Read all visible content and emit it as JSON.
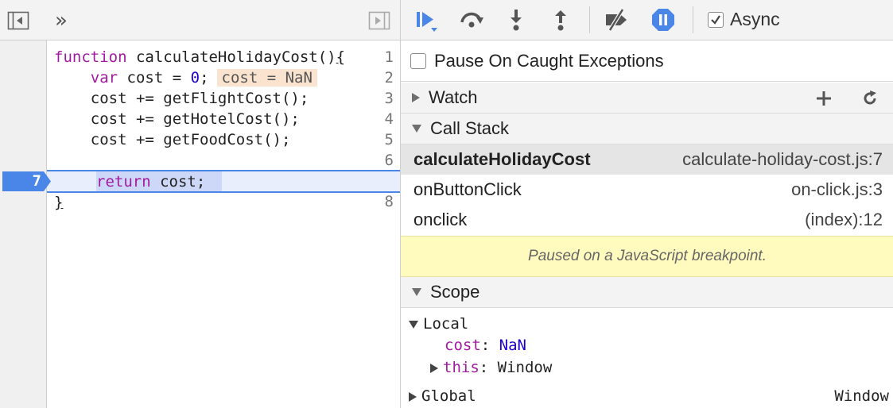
{
  "source": {
    "line_numbers": [
      "1",
      "2",
      "3",
      "4",
      "5",
      "6",
      "7",
      "8"
    ],
    "current_line": "7",
    "lines": {
      "l1_kw": "function",
      "l1_rest": " calculateHolidayCost()",
      "l1_brace": "{",
      "l2_indent": "    ",
      "l2_kw": "var",
      "l2_mid": " cost = ",
      "l2_num": "0",
      "l2_end": ";",
      "l2_inline": "cost = NaN",
      "l3": "    cost += getFlightCost();",
      "l4": "    cost += getHotelCost();",
      "l5": "    cost += getFoodCost();",
      "l7_kw": "return",
      "l7_rest": " cost;",
      "l8": "}"
    }
  },
  "toolbar": {
    "more_tabs": "»",
    "async_label": "Async",
    "async_checked": true
  },
  "pause_on_caught": {
    "label": "Pause On Caught Exceptions",
    "checked": false
  },
  "watch": {
    "title": "Watch"
  },
  "call_stack": {
    "title": "Call Stack",
    "frames": [
      {
        "name": "calculateHolidayCost",
        "location": "calculate-holiday-cost.js:7"
      },
      {
        "name": "onButtonClick",
        "location": "on-click.js:3"
      },
      {
        "name": "onclick",
        "location": "(index):12"
      }
    ]
  },
  "paused_message": "Paused on a JavaScript breakpoint.",
  "scope": {
    "title": "Scope",
    "local": {
      "label": "Local",
      "cost_name": "cost",
      "cost_value": "NaN",
      "this_name": "this",
      "this_value": "Window"
    },
    "global": {
      "label": "Global",
      "value": "Window"
    }
  },
  "colors": {
    "accent": "#4a86e8",
    "keyword": "#a21aa1",
    "number": "#1c00cf",
    "paused_bg": "#fffbbf"
  },
  "icons": [
    "show-navigator-icon",
    "more-tabs-icon",
    "hide-debugger-icon",
    "resume-icon",
    "step-over-icon",
    "step-into-icon",
    "step-out-icon",
    "deactivate-breakpoints-icon",
    "pause-on-exceptions-icon",
    "add-watch-icon",
    "refresh-watch-icon"
  ]
}
